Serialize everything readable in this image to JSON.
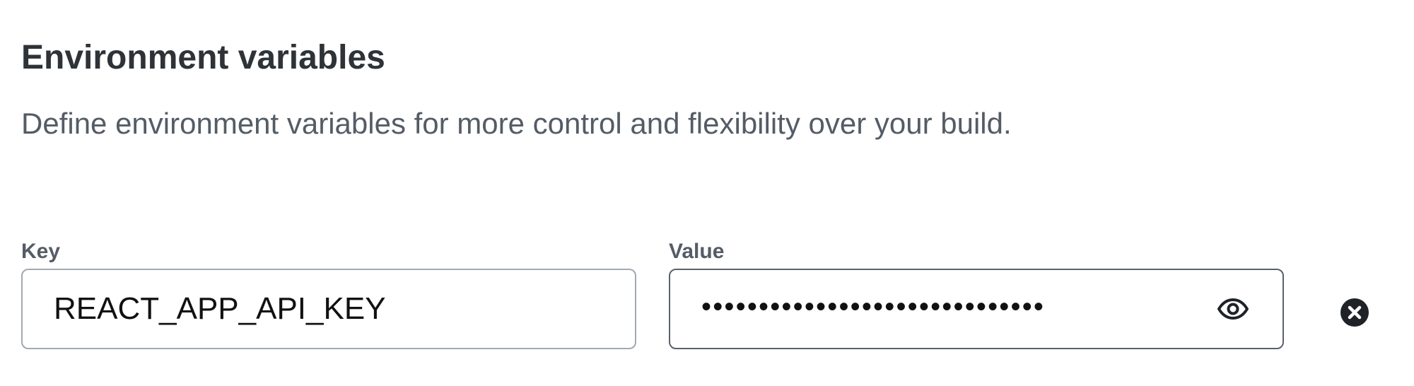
{
  "section": {
    "title": "Environment variables",
    "description": "Define environment variables for more control and flexibility over your build."
  },
  "env_var": {
    "key_label": "Key",
    "key_value": "REACT_APP_API_KEY",
    "value_label": "Value",
    "value_masked": "••••••••••••••••••••••••••••••",
    "reveal_icon": "eye-icon",
    "remove_icon": "close-circle-icon"
  },
  "colors": {
    "heading": "#2e3338",
    "muted_text": "#545c66",
    "input_border": "#a3a9b1",
    "input_border_active": "#5b6169",
    "icon": "#1f2328"
  }
}
